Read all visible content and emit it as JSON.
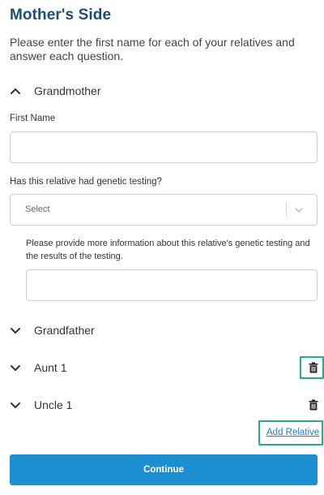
{
  "page": {
    "title": "Mother's Side",
    "intro": "Please enter the first name for each of your relatives and answer each question."
  },
  "grandmother": {
    "label": "Grandmother",
    "expanded": true,
    "first_name_label": "First Name",
    "first_name_value": "",
    "genetic_testing_label": "Has this relative had genetic testing?",
    "genetic_testing_selected": "Select",
    "more_info_label": "Please provide more information about this relative's genetic testing and the results of the testing.",
    "more_info_value": ""
  },
  "relatives": [
    {
      "label": "Grandfather",
      "expanded": false,
      "deletable": false
    },
    {
      "label": "Aunt 1",
      "expanded": false,
      "deletable": true,
      "highlighted": true
    },
    {
      "label": "Uncle 1",
      "expanded": false,
      "deletable": true,
      "highlighted": false
    }
  ],
  "actions": {
    "add_relative": "Add Relative",
    "continue": "Continue"
  },
  "icons": {
    "expanded": "chevron-up-icon",
    "collapsed": "chevron-down-icon",
    "delete": "trash-icon",
    "select_arrow": "chevron-down-icon"
  },
  "colors": {
    "title": "#1d4f74",
    "primary_button": "#1d8fd1",
    "link": "#1e7ec6",
    "highlight": "#2aa989"
  }
}
